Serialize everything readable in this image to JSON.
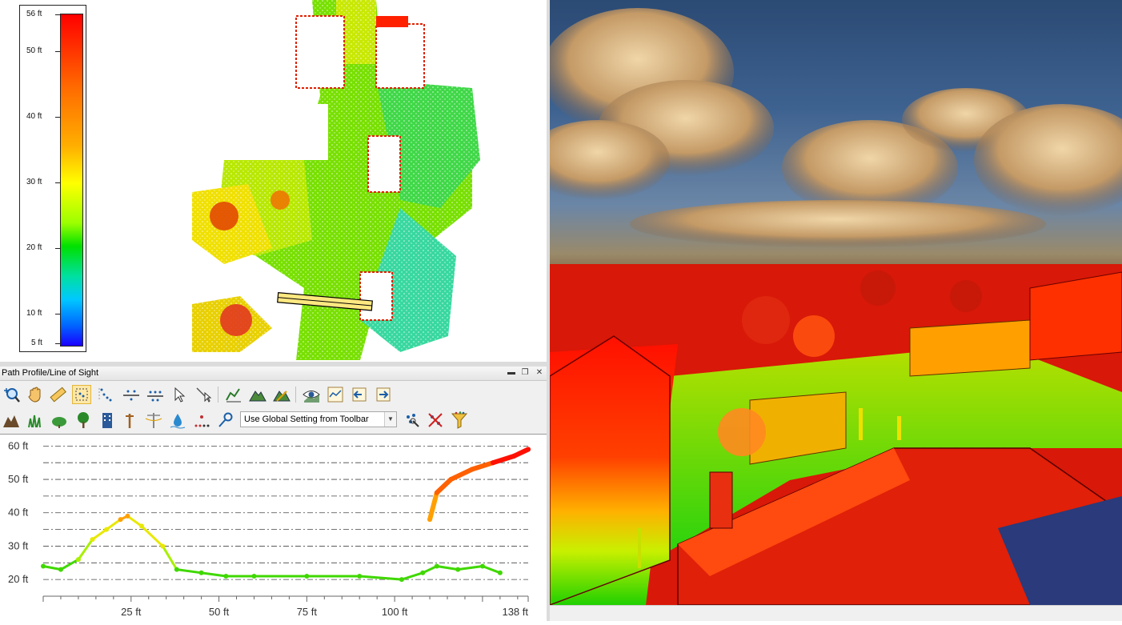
{
  "legend": {
    "ticks": [
      "56 ft",
      "50 ft",
      "40 ft",
      "30 ft",
      "20 ft",
      "10 ft",
      "5 ft"
    ],
    "tick_values": [
      56,
      50,
      40,
      30,
      20,
      10,
      5
    ],
    "colors": [
      "#ff0000",
      "#ff6a00",
      "#ffb000",
      "#ffff00",
      "#9cff00",
      "#00e000",
      "#00e0a0",
      "#00c8ff",
      "#0064ff",
      "#1a00ff"
    ]
  },
  "profile_panel": {
    "title": "Path Profile/Line of Sight",
    "window_buttons": [
      "▬",
      "❐",
      "✕"
    ],
    "toolbar1": [
      {
        "icon": "zoom-icon"
      },
      {
        "icon": "pan-hand-icon"
      },
      {
        "icon": "measure-ruler-icon"
      },
      {
        "icon": "select-points-icon",
        "selected": true
      },
      {
        "icon": "dotted-points-icon"
      },
      {
        "icon": "points-line-icon"
      },
      {
        "icon": "points-line-alt-icon"
      },
      {
        "icon": "pointer-icon"
      },
      {
        "icon": "pointer-line-icon"
      },
      {
        "icon": "profile-chart-icon"
      },
      {
        "icon": "terrain-icon"
      },
      {
        "icon": "terrain-edit-icon"
      },
      {
        "icon": "line-of-sight-eye-icon"
      },
      {
        "icon": "graph-icon"
      },
      {
        "icon": "step-back-icon"
      },
      {
        "icon": "step-forward-icon"
      }
    ],
    "toolbar2": [
      {
        "icon": "ground-icon"
      },
      {
        "icon": "grass-icon"
      },
      {
        "icon": "shrub-icon"
      },
      {
        "icon": "tree-icon"
      },
      {
        "icon": "building-icon"
      },
      {
        "icon": "pole-icon"
      },
      {
        "icon": "power-line-icon"
      },
      {
        "icon": "water-drop-icon"
      },
      {
        "icon": "noise-points-icon"
      },
      {
        "icon": "key-icon"
      },
      {
        "icon": "classify-icon"
      },
      {
        "icon": "unclassify-icon"
      },
      {
        "icon": "filter-funnel-icon"
      }
    ],
    "classification_dropdown": "Use Global Setting from Toolbar"
  },
  "chart_data": {
    "type": "scatter",
    "title": "",
    "xlabel": "",
    "ylabel": "",
    "y_ticks": [
      "60 ft",
      "50 ft",
      "40 ft",
      "30 ft",
      "20 ft"
    ],
    "y_tick_values": [
      60,
      50,
      40,
      30,
      20
    ],
    "x_ticks": [
      "25 ft",
      "50 ft",
      "75 ft",
      "100 ft",
      "138 ft"
    ],
    "x_tick_values": [
      25,
      50,
      75,
      100,
      138
    ],
    "xlim": [
      0,
      138
    ],
    "ylim": [
      15,
      62
    ],
    "grid": true,
    "series": [
      {
        "x": [
          0,
          5,
          10,
          14,
          18,
          22,
          24,
          28,
          34,
          38,
          45,
          52,
          60,
          75,
          90,
          102,
          108,
          112,
          118,
          125,
          130
        ],
        "y": [
          24,
          23,
          26,
          32,
          35,
          38,
          39,
          36,
          30,
          23,
          22,
          21,
          21,
          21,
          21,
          20,
          22,
          24,
          23,
          24,
          22
        ]
      },
      {
        "x": [
          110,
          112,
          116,
          122,
          128,
          134,
          138
        ],
        "y": [
          38,
          46,
          50,
          53,
          55,
          57,
          59
        ]
      }
    ]
  }
}
